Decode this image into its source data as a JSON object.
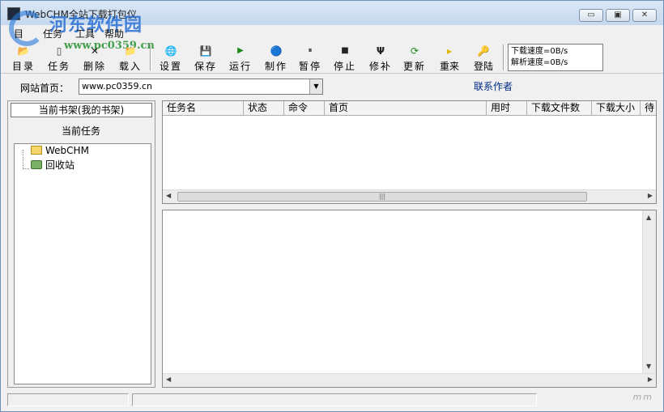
{
  "window": {
    "title": "WebCHM全站下载打包仪",
    "min_symbol": "▭",
    "max_symbol": "▣",
    "close_symbol": "✕"
  },
  "watermark": {
    "logo_text": "河东软件园",
    "url": "www.pc0359.cn"
  },
  "menu": [
    "目",
    "任务",
    "工具",
    "帮助"
  ],
  "toolbar": {
    "buttons": [
      {
        "label": "目录",
        "icon": "folder-icon",
        "glyph": "📂"
      },
      {
        "label": "任务",
        "icon": "document-icon",
        "glyph": "▯"
      },
      {
        "label": "删除",
        "icon": "delete-x-icon",
        "glyph": "✕"
      },
      {
        "label": "载入",
        "icon": "load-folder-icon",
        "glyph": "📁"
      },
      {
        "label": "设置",
        "icon": "globe-icon",
        "glyph": "🌐"
      },
      {
        "label": "保存",
        "icon": "save-disk-icon",
        "glyph": "💾"
      },
      {
        "label": "运行",
        "icon": "play-icon",
        "glyph": "▶"
      },
      {
        "label": "制作",
        "icon": "make-icon",
        "glyph": "🔵"
      },
      {
        "label": "暂停",
        "icon": "pause-icon",
        "glyph": "⏸"
      },
      {
        "label": "停止",
        "icon": "stop-icon",
        "glyph": "■"
      },
      {
        "label": "修补",
        "icon": "repair-tool-icon",
        "glyph": "Ψ"
      },
      {
        "label": "更新",
        "icon": "refresh-icon",
        "glyph": "⟳"
      },
      {
        "label": "重来",
        "icon": "restart-arrow-icon",
        "glyph": "▸"
      },
      {
        "label": "登陆",
        "icon": "login-key-icon",
        "glyph": "🔑"
      }
    ],
    "download_speed": "下载速度=0B/s",
    "parse_speed": "解析速度=0B/s"
  },
  "address": {
    "label": "网站首页：",
    "value": "www.pc0359.cn",
    "dropdown_glyph": "▼"
  },
  "contact_link": "联系作者",
  "left_panel": {
    "shelf_button": "当前书架(我的书架)",
    "current_task_label": "当前任务",
    "tree": [
      {
        "label": "WebCHM",
        "icon": "folder-icon"
      },
      {
        "label": "回收站",
        "icon": "recycle-bin-icon"
      }
    ]
  },
  "task_table": {
    "columns": [
      "任务名",
      "状态",
      "命令",
      "首页",
      "用时",
      "下载文件数",
      "下载大小",
      "待"
    ]
  },
  "scroll": {
    "left_arrow": "◀",
    "right_arrow": "▶",
    "up_arrow": "▲",
    "down_arrow": "▼",
    "grip": "|||"
  },
  "status": {
    "corner_mark": "ⅿⅿ"
  }
}
